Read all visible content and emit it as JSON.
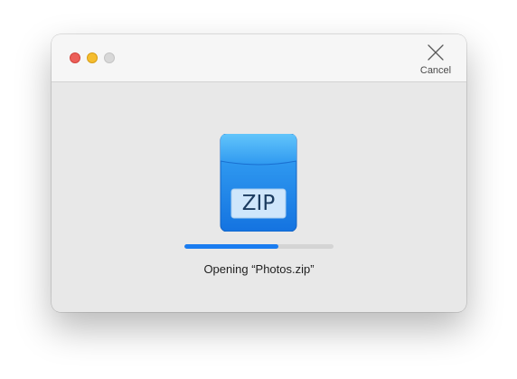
{
  "window": {
    "controls": [
      "close",
      "minimize",
      "zoom"
    ]
  },
  "toolbar": {
    "cancel_label": "Cancel",
    "cancel_icon": "close-x-icon"
  },
  "archive": {
    "icon": "zip-archive-icon",
    "badge_text": "ZIP",
    "accent_color": "#1a7cf0"
  },
  "progress": {
    "fraction": 0.63
  },
  "status": {
    "message": "Opening “Photos.zip”"
  }
}
